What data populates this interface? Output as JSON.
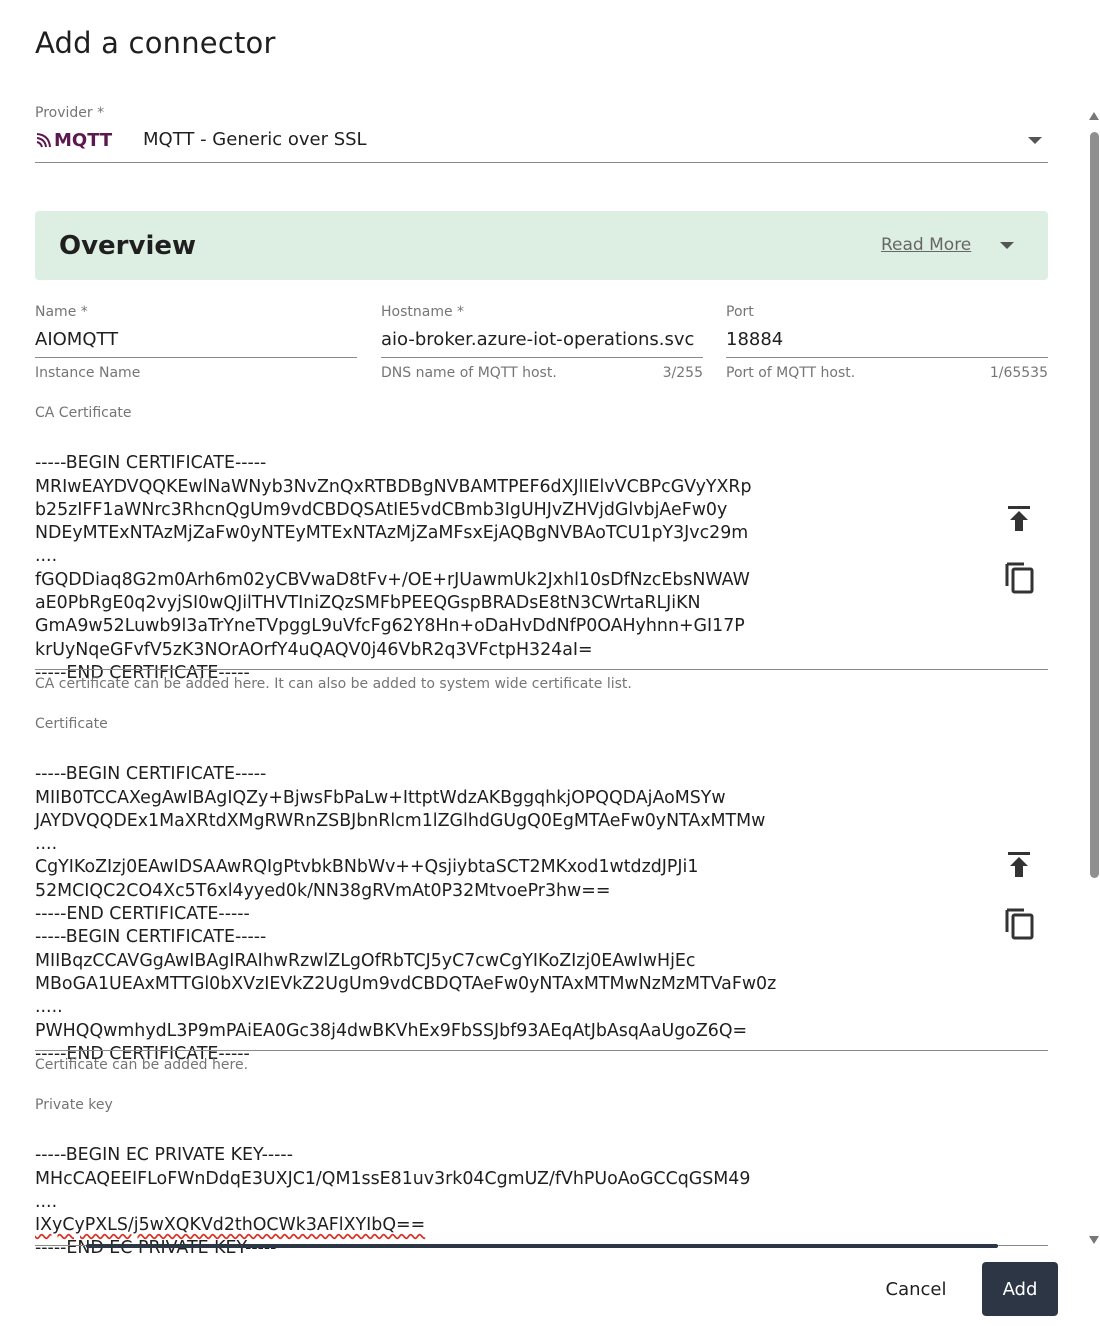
{
  "dialog": {
    "title": "Add a connector"
  },
  "provider": {
    "label": "Provider *",
    "logo_text": "MQTT",
    "value": "MQTT - Generic over SSL"
  },
  "overview": {
    "title": "Overview",
    "read_more": "Read More"
  },
  "fields": {
    "name": {
      "label": "Name *",
      "value": "AIOMQTT",
      "hint": "Instance Name"
    },
    "hostname": {
      "label": "Hostname *",
      "value": "aio-broker.azure-iot-operations.svc",
      "hint": "DNS name of MQTT host.",
      "counter": "3/255"
    },
    "port": {
      "label": "Port",
      "value": "18884",
      "hint": "Port of MQTT host.",
      "counter": "1/65535"
    }
  },
  "ca_certificate": {
    "label": "CA Certificate",
    "lines": [
      "-----BEGIN CERTIFICATE-----",
      "MRIwEAYDVQQKEwlNaWNyb3NvZnQxRTBDBgNVBAMTPEF6dXJlIElvVCBPcGVyYXRp",
      "b25zIFF1aWNrc3RhcnQgUm9vdCBDQSAtIE5vdCBmb3IgUHJvZHVjdGlvbjAeFw0y",
      "NDEyMTExNTAzMjZaFw0yNTEyMTExNTAzMjZaMFsxEjAQBgNVBAoTCU1pY3Jvc29m",
      "....",
      "fGQDDiaq8G2m0Arh6m02yCBVwaD8tFv+/OE+rJUawmUk2Jxhl10sDfNzcEbsNWAW",
      "aE0PbRgE0q2vyjSI0wQJilTHVTIniZQzSMFbPEEQGspBRADsE8tN3CWrtaRLJiKN",
      "GmA9w52Luwb9l3aTrYneTVpggL9uVfcFg62Y8Hn+oDaHvDdNfP0OAHyhnn+GI17P",
      "krUyNqeGFvfV5zK3NOrAOrfY4uQAQV0j46VbR2q3VFctpH324aI=",
      "-----END CERTIFICATE-----"
    ],
    "hint": "CA certificate can be added here. It can also be added to system wide certificate list."
  },
  "certificate": {
    "label": "Certificate",
    "lines": [
      "-----BEGIN CERTIFICATE-----",
      "MIIB0TCCAXegAwIBAgIQZy+BjwsFbPaLw+IttptWdzAKBggqhkjOPQQDAjAoMSYw",
      "JAYDVQQDEx1MaXRtdXMgRWRnZSBJbnRlcm1lZGlhdGUgQ0EgMTAeFw0yNTAxMTMw",
      "....",
      "CgYIKoZIzj0EAwIDSAAwRQIgPtvbkBNbWv++QsjiybtaSCT2MKxod1wtdzdJPJi1",
      "52MCIQC2CO4Xc5T6xl4yyed0k/NN38gRVmAt0P32MtvoePr3hw==",
      "-----END CERTIFICATE-----",
      "-----BEGIN CERTIFICATE-----",
      "MIIBqzCCAVGgAwIBAgIRAIhwRzwlZLgOfRbTCJ5yC7cwCgYIKoZIzj0EAwIwHjEc",
      "MBoGA1UEAxMTTGl0bXVzIEVkZ2UgUm9vdCBDQTAeFw0yNTAxMTMwNzMzMTVaFw0z",
      ".....",
      "PWHQQwmhydL3P9mPAiEA0Gc38j4dwBKVhEx9FbSSJbf93AEqAtJbAsqAaUgoZ6Q=",
      "-----END CERTIFICATE-----"
    ],
    "hint": "Certificate can be added here."
  },
  "private_key": {
    "label": "Private key",
    "lines": [
      "-----BEGIN EC PRIVATE KEY-----",
      "MHcCAQEEIFLoFWnDdqE3UXJC1/QM1ssE81uv3rk04CgmUZ/fVhPUoAoGCCqGSM49",
      "....",
      "IXyCyPXLS/j5wXQKVd2thOCWk3AFlXYIbQ==",
      "-----END EC PRIVATE KEY-----"
    ]
  },
  "icons": {
    "upload": "upload-icon",
    "copy": "copy-icon",
    "dropdown": "chevron-down-icon"
  },
  "actions": {
    "cancel": "Cancel",
    "add": "Add"
  },
  "colors": {
    "overview_bg": "#dcefe2",
    "primary_button": "#2d3644",
    "mqtt_logo": "#5b1a4f"
  }
}
